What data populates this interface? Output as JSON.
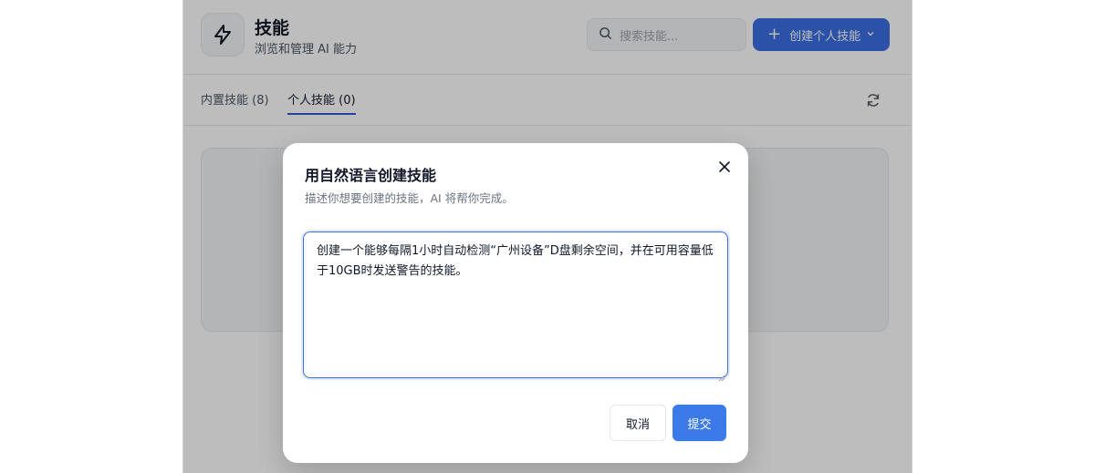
{
  "header": {
    "app_icon": "lightning-icon",
    "title": "技能",
    "subtitle": "浏览和管理 AI 能力",
    "search": {
      "placeholder": "搜索技能...",
      "icon": "search-icon"
    },
    "create_button": {
      "label": "创建个人技能",
      "icon": "plus-icon",
      "dropdown_icon": "chevron-down-icon"
    }
  },
  "tabs": [
    {
      "label": "内置技能 (8)",
      "active": false
    },
    {
      "label": "个人技能 (0)",
      "active": true
    }
  ],
  "refresh_icon": "refresh-icon",
  "modal": {
    "title": "用自然语言创建技能",
    "description": "描述你想要创建的技能，AI 将帮你完成。",
    "close_icon": "close-icon",
    "input_value": "创建一个能够每隔1小时自动检测“广州设备”D盘剩余空间，并在可用容量低于10GB时发送警告的技能。",
    "cancel_label": "取消",
    "submit_label": "提交"
  },
  "colors": {
    "primary": "#3b6fe0",
    "active_tab_underline": "#2f5bd3",
    "overlay": "rgba(0,0,0,0.26)"
  }
}
